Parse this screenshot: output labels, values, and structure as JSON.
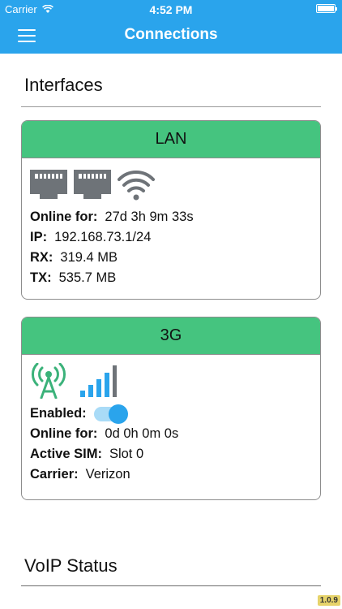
{
  "status_bar": {
    "carrier": "Carrier",
    "time": "4:52 PM"
  },
  "nav": {
    "title": "Connections"
  },
  "interfaces_title": "Interfaces",
  "lan": {
    "header": "LAN",
    "online_for_label": "Online for:",
    "online_for_value": "27d 3h 9m 33s",
    "ip_label": "IP:",
    "ip_value": "192.168.73.1/24",
    "rx_label": "RX:",
    "rx_value": "319.4 MB",
    "tx_label": "TX:",
    "tx_value": "535.7 MB"
  },
  "g3": {
    "header": "3G",
    "enabled_label": "Enabled:",
    "enabled": true,
    "online_for_label": "Online for:",
    "online_for_value": "0d 0h 0m 0s",
    "active_sim_label": "Active SIM:",
    "active_sim_value": "Slot 0",
    "carrier_label": "Carrier:",
    "carrier_value": "Verizon",
    "signal_bars": 4
  },
  "voip_title": "VoIP Status",
  "version": "1.0.9",
  "colors": {
    "nav_blue": "#2aa4ec",
    "header_green": "#45c47f",
    "icon_gray": "#6e7378",
    "tower_green": "#3bb27a",
    "signal_blue": "#2aa4ec"
  },
  "icons": {
    "ethernet": "ethernet-port-icon",
    "wifi": "wifi-icon",
    "tower": "cell-tower-icon",
    "signal": "signal-bars-icon",
    "menu": "hamburger-menu-icon"
  }
}
